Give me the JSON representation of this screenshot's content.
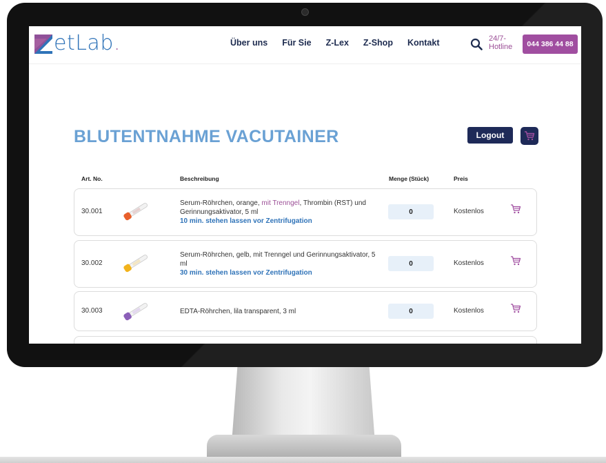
{
  "site": {
    "logo_text": "etLab",
    "logo_dot": ".",
    "nav": [
      "Über uns",
      "Für Sie",
      "Z-Lex",
      "Z-Shop",
      "Kontakt"
    ],
    "hotline_label": "24/7-Hotline",
    "phone": "044 386 44 88"
  },
  "page": {
    "title": "BLUTENTNAHME VACUTAINER",
    "logout_label": "Logout"
  },
  "table": {
    "columns": [
      "Art. No.",
      "Beschreibung",
      "Menge (Stück)",
      "Preis"
    ],
    "rows": [
      {
        "art_no": "30.001",
        "desc_before": "Serum-Röhrchen, orange, ",
        "desc_accent": "mit Trenngel",
        "desc_after": ", Thrombin (RST) und Gerinnungsaktivator, 5 ml",
        "note": "10 min. stehen lassen vor Zentrifugation",
        "quantity": "0",
        "price": "Kostenlos",
        "tube_color": "#e8602c"
      },
      {
        "art_no": "30.002",
        "desc_before": "Serum-Röhrchen, gelb, mit Trenngel und Gerinnungsaktivator, 5 ml",
        "desc_accent": "",
        "desc_after": "",
        "note": "30 min. stehen lassen vor Zentrifugation",
        "quantity": "0",
        "price": "Kostenlos",
        "tube_color": "#f2b31c"
      },
      {
        "art_no": "30.003",
        "desc_before": "EDTA-Röhrchen, lila transparent, 3 ml",
        "desc_accent": "",
        "desc_after": "",
        "note": "",
        "quantity": "0",
        "price": "Kostenlos",
        "tube_color": "#8b5fb8"
      }
    ]
  },
  "colors": {
    "brand_blue": "#2f73b8",
    "brand_purple": "#a04ea0",
    "title_blue": "#6aa1d4",
    "dark_navy": "#1e2a58"
  }
}
